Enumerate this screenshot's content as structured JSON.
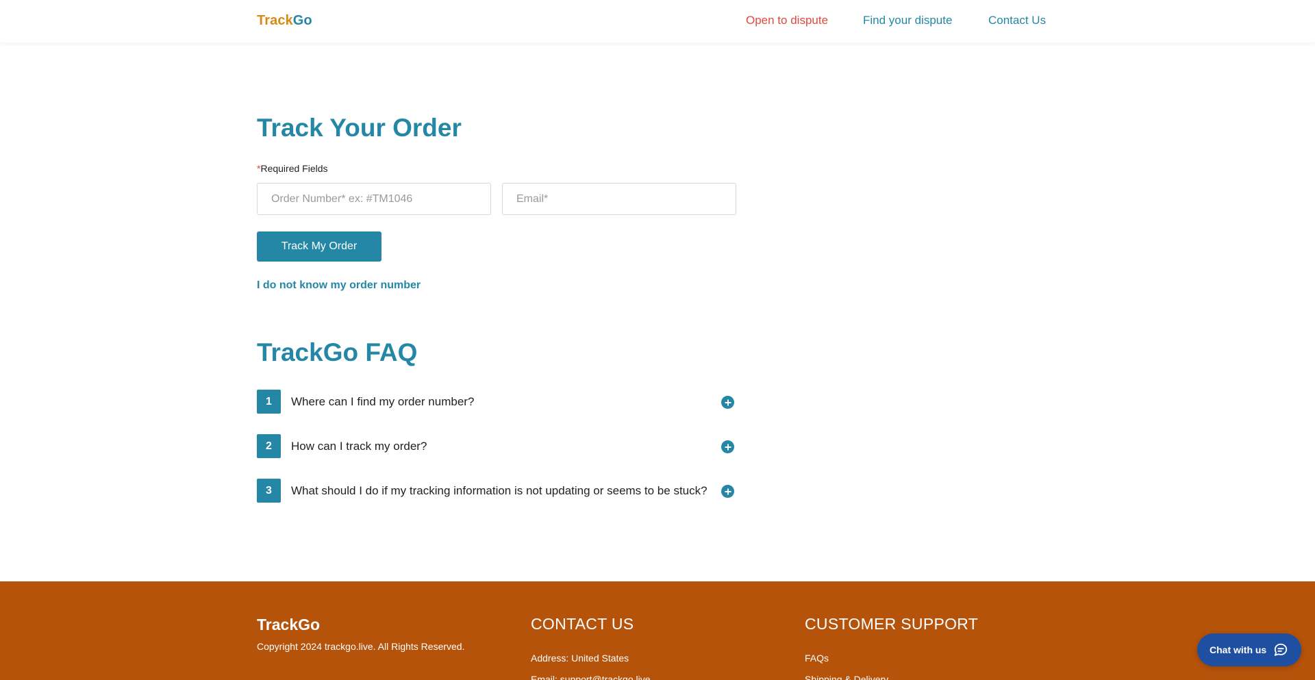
{
  "header": {
    "logo_part1": "Track",
    "logo_part2": "Go",
    "nav": {
      "open_dispute": "Open to dispute",
      "find_dispute": "Find your dispute",
      "contact": "Contact Us"
    }
  },
  "track": {
    "title": "Track Your Order",
    "required_star": "*",
    "required_label": "Required Fields",
    "order_placeholder": "Order Number* ex: #TM1046",
    "email_placeholder": "Email*",
    "button_label": "Track My Order",
    "dont_know_link": "I do not know my order number"
  },
  "faq": {
    "title": "TrackGo FAQ",
    "items": [
      {
        "num": "1",
        "question": "Where can I find my order number?"
      },
      {
        "num": "2",
        "question": "How can I track my order?"
      },
      {
        "num": "3",
        "question": "What should I do if my tracking information is not updating or seems to be stuck?"
      }
    ]
  },
  "footer": {
    "logo": "TrackGo",
    "copyright": "Copyright 2024 trackgo.live. All Rights Reserved.",
    "contact_heading": "CONTACT US",
    "address": "Address: United States",
    "email": "Email: support@trackgo.live",
    "support_heading": "CUSTOMER SUPPORT",
    "support_links": [
      "FAQs",
      "Shipping & Delivery"
    ]
  },
  "chat": {
    "label": "Chat with us",
    "icon": "chat-bubble-icon"
  },
  "colors": {
    "primary": "#2587a6",
    "logo_orange": "#d98a12",
    "dispute_red": "#e0493f",
    "footer_bg": "#b5530b",
    "chat_bg": "#1f4fa0"
  }
}
